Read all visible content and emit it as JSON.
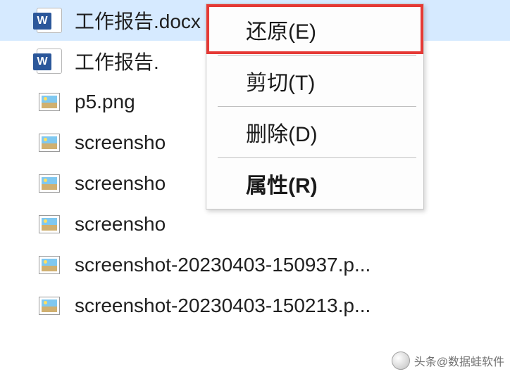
{
  "files": [
    {
      "name": "工作报告.docx",
      "type": "word",
      "selected": true
    },
    {
      "name": "工作报告.docx",
      "type": "word",
      "selected": false,
      "display": "工作报告."
    },
    {
      "name": "p5.png",
      "type": "image",
      "selected": false
    },
    {
      "name": "screenshot",
      "type": "image",
      "selected": false,
      "display": "screensho"
    },
    {
      "name": "screenshot",
      "type": "image",
      "selected": false,
      "display": "screensho"
    },
    {
      "name": "screenshot",
      "type": "image",
      "selected": false,
      "display": "screensho"
    },
    {
      "name": "screenshot-20230403-150937.p...",
      "type": "image",
      "selected": false
    },
    {
      "name": "screenshot-20230403-150213.p...",
      "type": "image",
      "selected": false
    }
  ],
  "context_menu": {
    "restore": "还原(E)",
    "cut": "剪切(T)",
    "delete": "删除(D)",
    "properties": "属性(R)"
  },
  "watermark": {
    "prefix": "头条",
    "author": "@数据蛙软件"
  }
}
